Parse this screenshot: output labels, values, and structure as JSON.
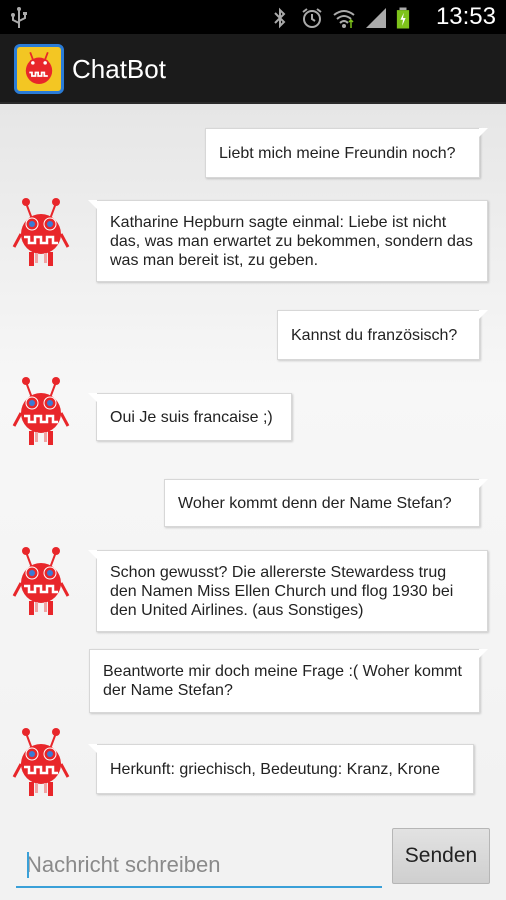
{
  "status_bar": {
    "time": "13:53",
    "icons": [
      "usb-icon",
      "bluetooth-icon",
      "alarm-icon",
      "wifi-icon",
      "signal-icon",
      "battery-charging-icon"
    ]
  },
  "app": {
    "title": "ChatBot"
  },
  "messages": [
    {
      "sender": "user",
      "text": "Liebt mich meine Freundin noch?"
    },
    {
      "sender": "bot",
      "text": "Katharine Hepburn sagte einmal: Liebe ist nicht das, was man erwartet zu bekommen, sondern das was man bereit ist, zu geben."
    },
    {
      "sender": "user",
      "text": "Kannst du französisch?"
    },
    {
      "sender": "bot",
      "text": "Oui Je suis francaise ;)"
    },
    {
      "sender": "user",
      "text": "Woher kommt denn der Name Stefan?"
    },
    {
      "sender": "bot",
      "text": "Schon gewusst? Die allererste Stewardess trug den Namen Miss Ellen Church und flog 1930 bei den United Airlines. (aus Sonstiges)"
    },
    {
      "sender": "user",
      "text": "Beantworte mir doch meine Frage :( Woher kommt der Name Stefan?"
    },
    {
      "sender": "bot",
      "text": "Herkunft: griechisch, Bedeutung: Kranz, Krone"
    }
  ],
  "composer": {
    "placeholder": "Nachricht schreiben",
    "value": "",
    "send_label": "Senden"
  },
  "colors": {
    "avatar": "#e8262a",
    "accent": "#3aa0d8",
    "action_bar": "#1b1b1b"
  }
}
